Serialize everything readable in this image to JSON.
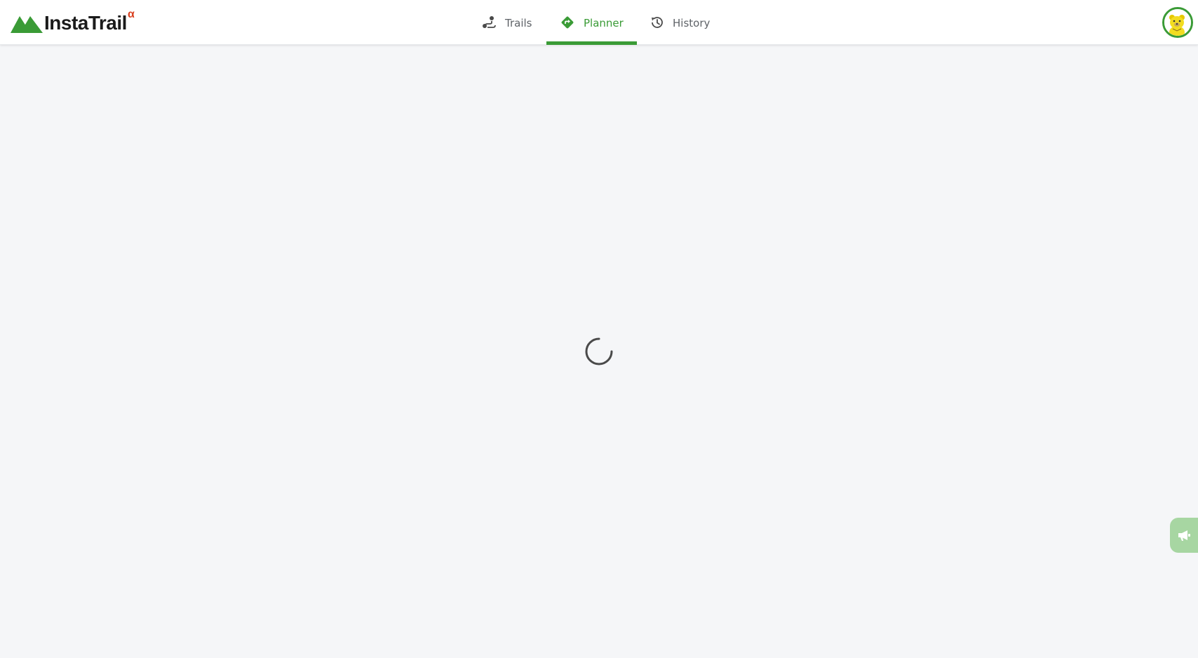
{
  "brand": {
    "name": "InstaTrail",
    "superscript": "α",
    "primary_color": "#3a9b36",
    "accent_color": "#d9401f"
  },
  "nav": {
    "tabs": [
      {
        "label": "Trails",
        "icon": "route-icon",
        "active": false
      },
      {
        "label": "Planner",
        "icon": "directions-icon",
        "active": true
      },
      {
        "label": "History",
        "icon": "history-icon",
        "active": false
      }
    ]
  },
  "user": {
    "avatar_icon": "bear-avatar-icon"
  },
  "main": {
    "state": "loading",
    "spinner_icon": "loading-spinner-icon"
  },
  "feedback": {
    "icon": "megaphone-icon"
  }
}
